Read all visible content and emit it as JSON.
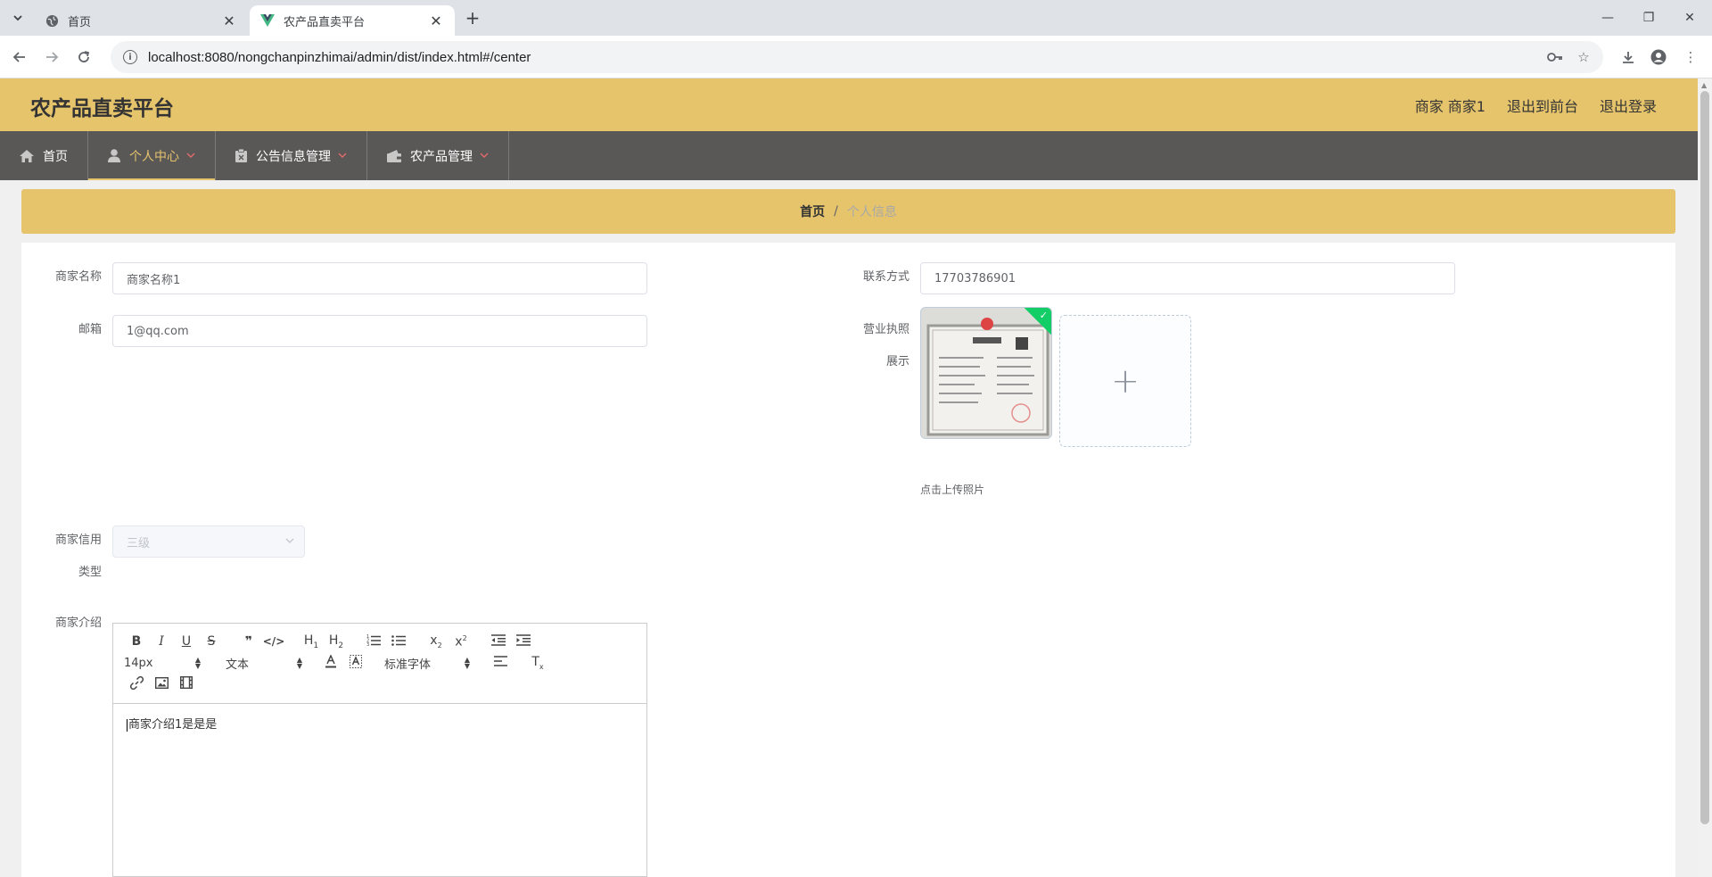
{
  "browser": {
    "tabs": [
      {
        "title": "首页",
        "active": false
      },
      {
        "title": "农产品直卖平台",
        "active": true
      }
    ],
    "url": "localhost:8080/nongchanpinzhimai/admin/dist/index.html#/center"
  },
  "header": {
    "brand": "农产品直卖平台",
    "user_label": "商家 商家1",
    "exit_front": "退出到前台",
    "logout": "退出登录"
  },
  "nav": {
    "items": [
      {
        "label": "首页",
        "icon": "home-icon"
      },
      {
        "label": "个人中心",
        "icon": "user-icon",
        "active": true
      },
      {
        "label": "公告信息管理",
        "icon": "clipboard-icon"
      },
      {
        "label": "农产品管理",
        "icon": "wallet-icon"
      }
    ]
  },
  "breadcrumb": {
    "home": "首页",
    "separator": "/",
    "current": "个人信息"
  },
  "form": {
    "merchant_name": {
      "label": "商家名称",
      "value": "商家名称1"
    },
    "phone": {
      "label": "联系方式",
      "value": "17703786901"
    },
    "email": {
      "label": "邮箱",
      "value": "1@qq.com"
    },
    "license": {
      "label_line1": "营业执照",
      "label_line2": "展示",
      "upload_tip": "点击上传照片"
    },
    "credit": {
      "label_line1": "商家信用",
      "label_line2": "类型",
      "value": "三级"
    },
    "intro": {
      "label": "商家介绍",
      "content": "商家介绍1是是是"
    }
  },
  "editor": {
    "font_size": "14px",
    "header_select": "文本",
    "font_family": "标准字体"
  },
  "colors": {
    "accent": "#e6c46c",
    "nav_bg": "#5a5757",
    "success": "#13ce66"
  }
}
